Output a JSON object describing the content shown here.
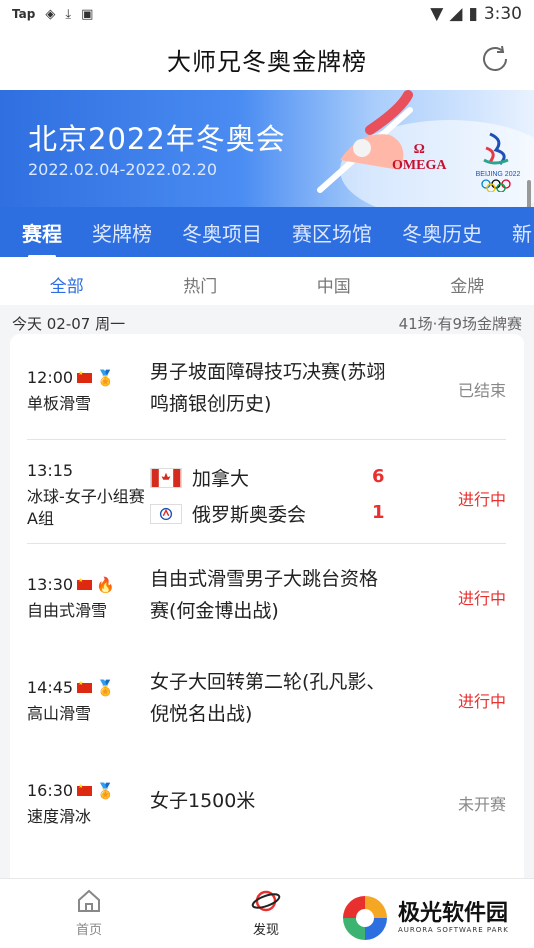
{
  "status_bar": {
    "carrier": "Tap",
    "time": "3:30"
  },
  "app_bar": {
    "title": "大师兄冬奥金牌榜"
  },
  "banner": {
    "title": "北京2022年冬奥会",
    "dates": "2022.02.04-2022.02.20",
    "sponsor": "OMEGA",
    "logo_text": "BEIJING 2022"
  },
  "main_tabs": [
    "赛程",
    "奖牌榜",
    "冬奥项目",
    "赛区场馆",
    "冬奥历史",
    "新"
  ],
  "sub_tabs": [
    "全部",
    "热门",
    "中国",
    "金牌"
  ],
  "date_row": {
    "date": "今天 02-07 周一",
    "summary": "41场·有9场金牌赛"
  },
  "events": [
    {
      "time": "12:00",
      "sport": "单板滑雪",
      "title": "男子坡面障碍技巧决赛(苏翊鸣摘银创历史)",
      "status": "已结束",
      "icon": "medal-icon"
    },
    {
      "time": "13:15",
      "sport": "冰球-女子小组赛A组",
      "team1": "加拿大",
      "score1": "6",
      "team2": "俄罗斯奥委会",
      "score2": "1",
      "status": "进行中"
    },
    {
      "time": "13:30",
      "sport": "自由式滑雪",
      "title": "自由式滑雪男子大跳台资格赛(何金博出战)",
      "status": "进行中",
      "icon": "fire-icon"
    },
    {
      "time": "14:45",
      "sport": "高山滑雪",
      "title": "女子大回转第二轮(孔凡影、倪悦名出战)",
      "status": "进行中",
      "icon": "medal-icon"
    },
    {
      "time": "16:30",
      "sport": "速度滑冰",
      "title": "女子1500米",
      "status": "未开赛",
      "icon": "medal-icon"
    }
  ],
  "bottom_nav": {
    "home": "首页",
    "discover": "发现"
  },
  "watermark": {
    "text": "极光软件园",
    "sub": "AURORA SOFTWARE PARK"
  },
  "colors": {
    "primary": "#2d6ee0",
    "live": "#e8312f"
  }
}
